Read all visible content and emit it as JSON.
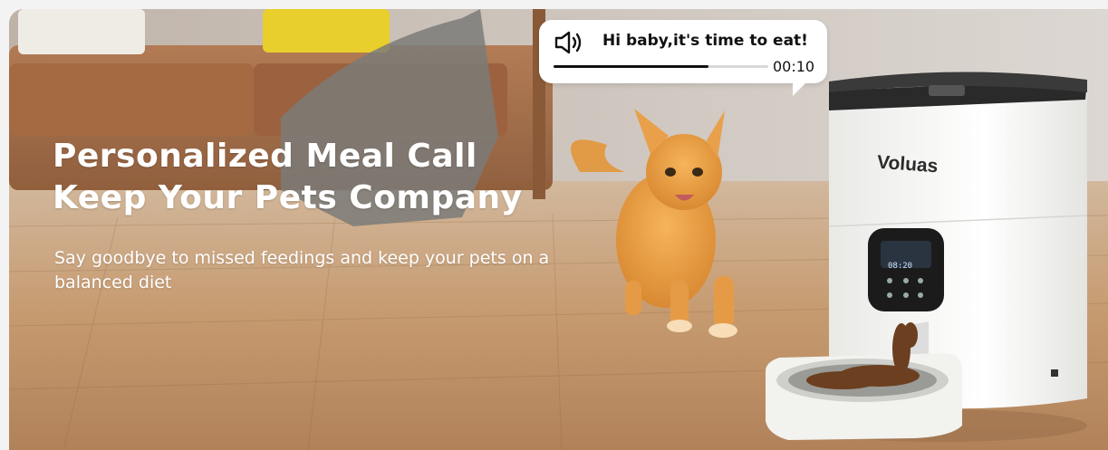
{
  "banner": {
    "headline_line1": "Personalized Meal Call",
    "headline_line2": "Keep Your Pets Company",
    "subtext": "Say goodbye to missed feedings and keep your pets on a balanced diet"
  },
  "bubble": {
    "icon": "speaker-icon",
    "message": "Hi baby,it's time to eat!",
    "progress": 0.72,
    "time": "00:10"
  },
  "product": {
    "brand": "Voluas",
    "display_time": "08:20"
  },
  "colors": {
    "text_light": "#ffffff",
    "bubble_bg": "#ffffff",
    "progress_fill": "#111111",
    "feeder_body": "#f4f4f2",
    "feeder_lid": "#2a2a2a"
  }
}
